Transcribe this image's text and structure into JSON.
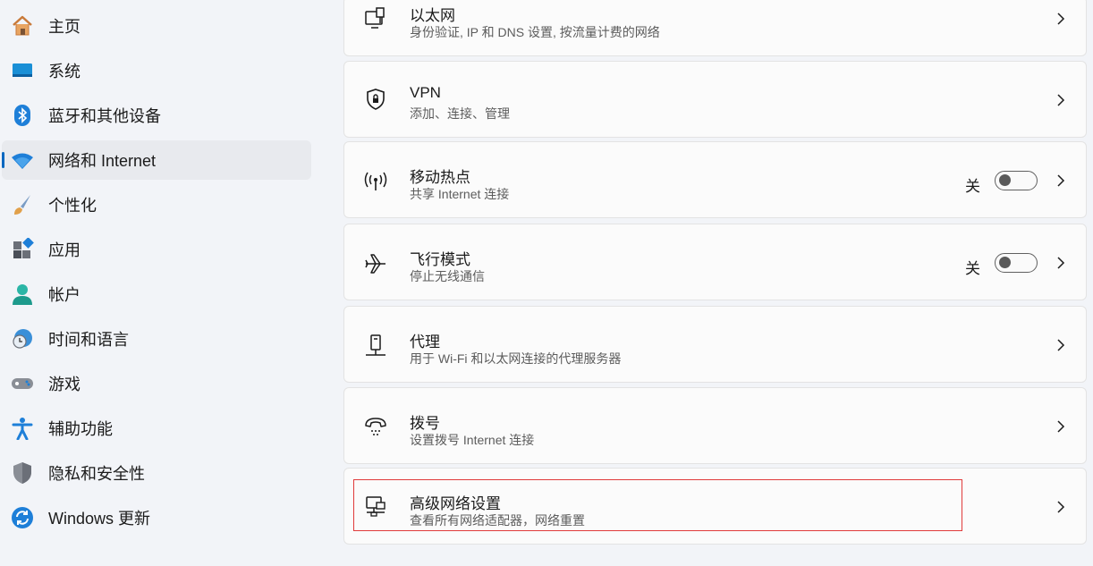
{
  "sidebar": {
    "items": [
      {
        "label": "主页",
        "icon": "home-icon"
      },
      {
        "label": "系统",
        "icon": "system-icon"
      },
      {
        "label": "蓝牙和其他设备",
        "icon": "bluetooth-icon"
      },
      {
        "label": "网络和 Internet",
        "icon": "wifi-icon",
        "selected": true
      },
      {
        "label": "个性化",
        "icon": "brush-icon"
      },
      {
        "label": "应用",
        "icon": "apps-icon"
      },
      {
        "label": "帐户",
        "icon": "account-icon"
      },
      {
        "label": "时间和语言",
        "icon": "time-language-icon"
      },
      {
        "label": "游戏",
        "icon": "gamepad-icon"
      },
      {
        "label": "辅助功能",
        "icon": "accessibility-icon"
      },
      {
        "label": "隐私和安全性",
        "icon": "shield-icon"
      },
      {
        "label": "Windows 更新",
        "icon": "update-icon"
      }
    ]
  },
  "cards": [
    {
      "title": "以太网",
      "subtitle": "身份验证, IP 和 DNS 设置, 按流量计费的网络",
      "icon": "ethernet-icon"
    },
    {
      "title": "VPN",
      "subtitle": "添加、连接、管理",
      "icon": "vpn-shield-icon"
    },
    {
      "title": "移动热点",
      "subtitle": "共享 Internet 连接",
      "icon": "hotspot-icon",
      "toggle": {
        "label": "关",
        "on": false
      }
    },
    {
      "title": "飞行模式",
      "subtitle": "停止无线通信",
      "icon": "airplane-icon",
      "toggle": {
        "label": "关",
        "on": false
      }
    },
    {
      "title": "代理",
      "subtitle": "用于 Wi-Fi 和以太网连接的代理服务器",
      "icon": "proxy-icon"
    },
    {
      "title": "拨号",
      "subtitle": "设置拨号 Internet 连接",
      "icon": "dialup-icon"
    },
    {
      "title": "高级网络设置",
      "subtitle": "查看所有网络适配器，网络重置",
      "icon": "advanced-network-icon"
    }
  ],
  "colors": {
    "accent": "#0067c0",
    "highlight": "#e03b3b"
  }
}
